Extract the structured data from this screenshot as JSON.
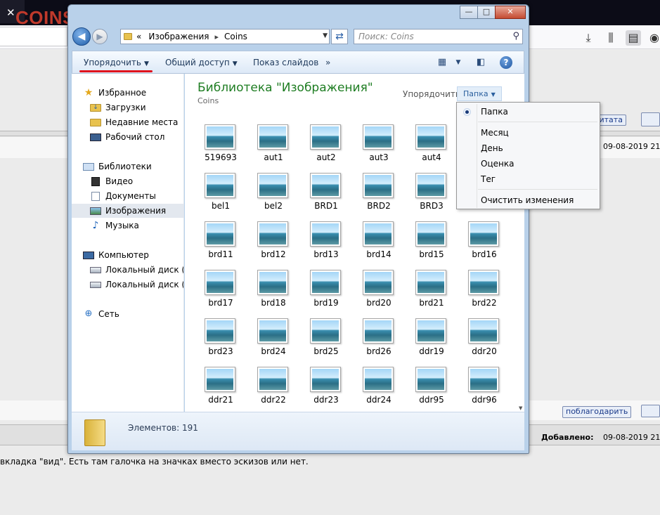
{
  "browser": {
    "watermark": "COINS.LAVE.RU",
    "tab_close": "✕"
  },
  "forum": {
    "thanks_button_top": "цитата",
    "date_top": "09-08-2019 21",
    "thanks_button_bottom": "поблагодарить",
    "added_label": "Добавлено:",
    "added_date": "09-08-2019 21",
    "post_text": "вкладка \"вид\". Есть там галочка на значках вместо эскизов или нет."
  },
  "explorer": {
    "window_controls": {
      "minimize": "—",
      "maximize": "□",
      "close": "✕"
    },
    "address": {
      "prefix": "«",
      "segment1": "Изображения",
      "separator": "▸",
      "segment2": "Coins"
    },
    "search": {
      "placeholder": "Поиск: Coins"
    },
    "commands": {
      "organize": "Упорядочить",
      "share": "Общий доступ",
      "slideshow": "Показ слайдов",
      "more": "»"
    },
    "nav": {
      "favorites": "Избранное",
      "downloads": "Загрузки",
      "recent": "Недавние места",
      "desktop": "Рабочий стол",
      "libraries": "Библиотеки",
      "video": "Видео",
      "documents": "Документы",
      "images": "Изображения",
      "music": "Музыка",
      "computer": "Компьютер",
      "local_c": "Локальный диск (C",
      "local_d": "Локальный диск (D",
      "network": "Сеть"
    },
    "library": {
      "title": "Библиотека \"Изображения\"",
      "subtitle": "Coins",
      "arrange_label": "Упорядочить:",
      "arrange_value": "Папка"
    },
    "files": [
      [
        "519693",
        "aut1",
        "aut2",
        "aut3",
        "aut4"
      ],
      [
        "bel1",
        "bel2",
        "BRD1",
        "BRD2",
        "BRD3"
      ],
      [
        "brd11",
        "brd12",
        "brd13",
        "brd14",
        "brd15",
        "brd16"
      ],
      [
        "brd17",
        "brd18",
        "brd19",
        "brd20",
        "brd21",
        "brd22"
      ],
      [
        "brd23",
        "brd24",
        "brd25",
        "brd26",
        "ddr19",
        "ddr20"
      ],
      [
        "ddr21",
        "ddr22",
        "ddr23",
        "ddr24",
        "ddr95",
        "ddr96"
      ]
    ],
    "status": "Элементов: 191"
  },
  "menu": {
    "selected": "Папка",
    "items": [
      "Папка",
      "Месяц",
      "День",
      "Оценка",
      "Тег"
    ],
    "clear": "Очистить изменения"
  }
}
